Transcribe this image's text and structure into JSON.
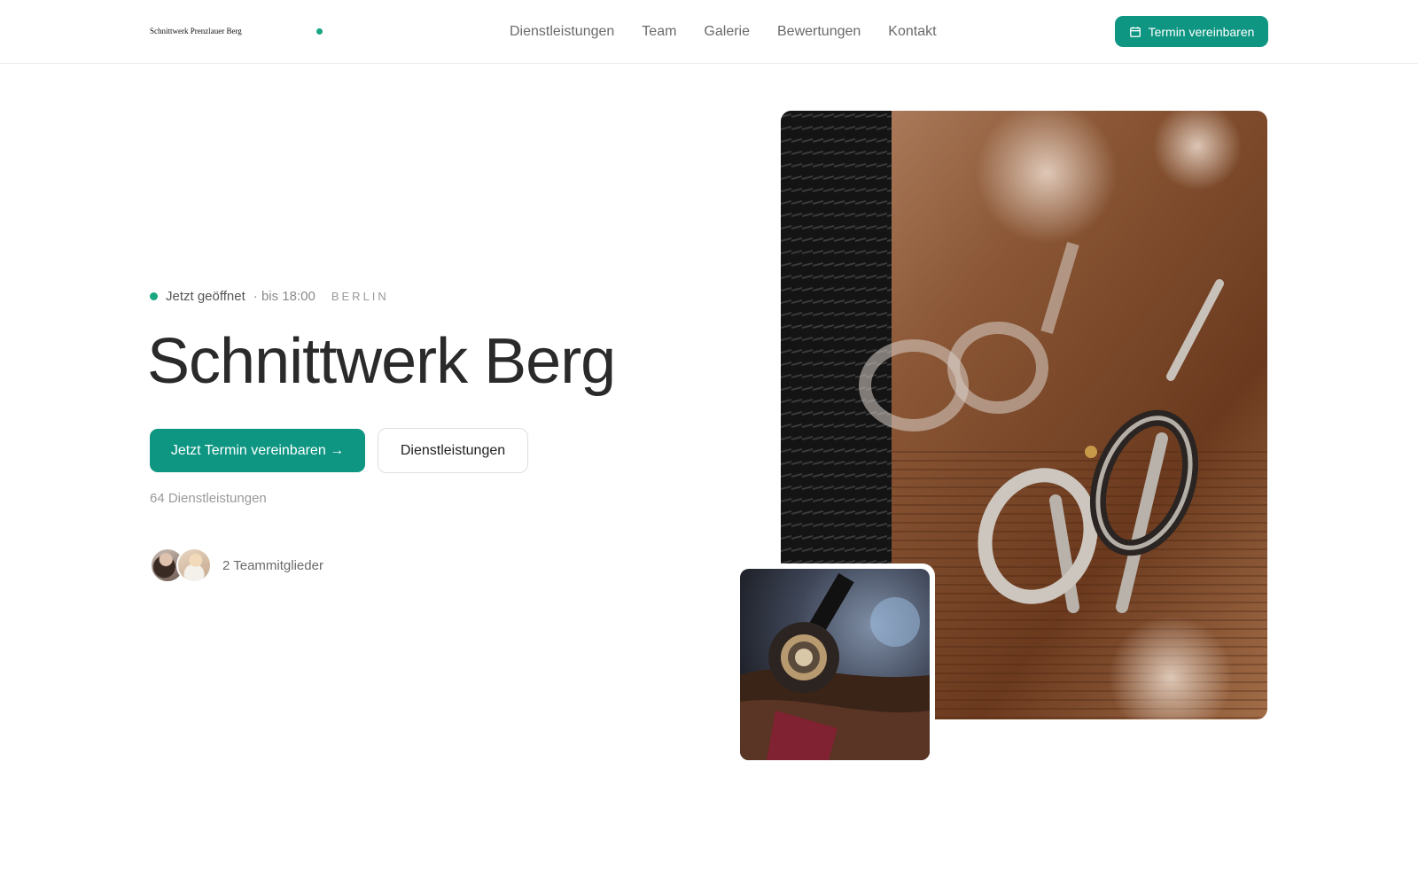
{
  "header": {
    "logo": "Schnittwerk Prenzlauer Berg",
    "nav": [
      "Dienstleistungen",
      "Team",
      "Galerie",
      "Bewertungen",
      "Kontakt"
    ],
    "cta_label": "Termin vereinbaren",
    "cta_icon": "calendar-icon"
  },
  "hero": {
    "status": "Jetzt geöffnet",
    "hours": "· bis 18:00",
    "city": "BERLIN",
    "title": "Schnittwerk Berg",
    "primary_label": "Jetzt Termin vereinbaren →",
    "secondary_label": "Dienstleistungen",
    "services_count": "64 Dienstleistungen",
    "team_label": "2 Teammitglieder"
  },
  "colors": {
    "accent": "#0e9683",
    "status_green": "#19a680"
  }
}
